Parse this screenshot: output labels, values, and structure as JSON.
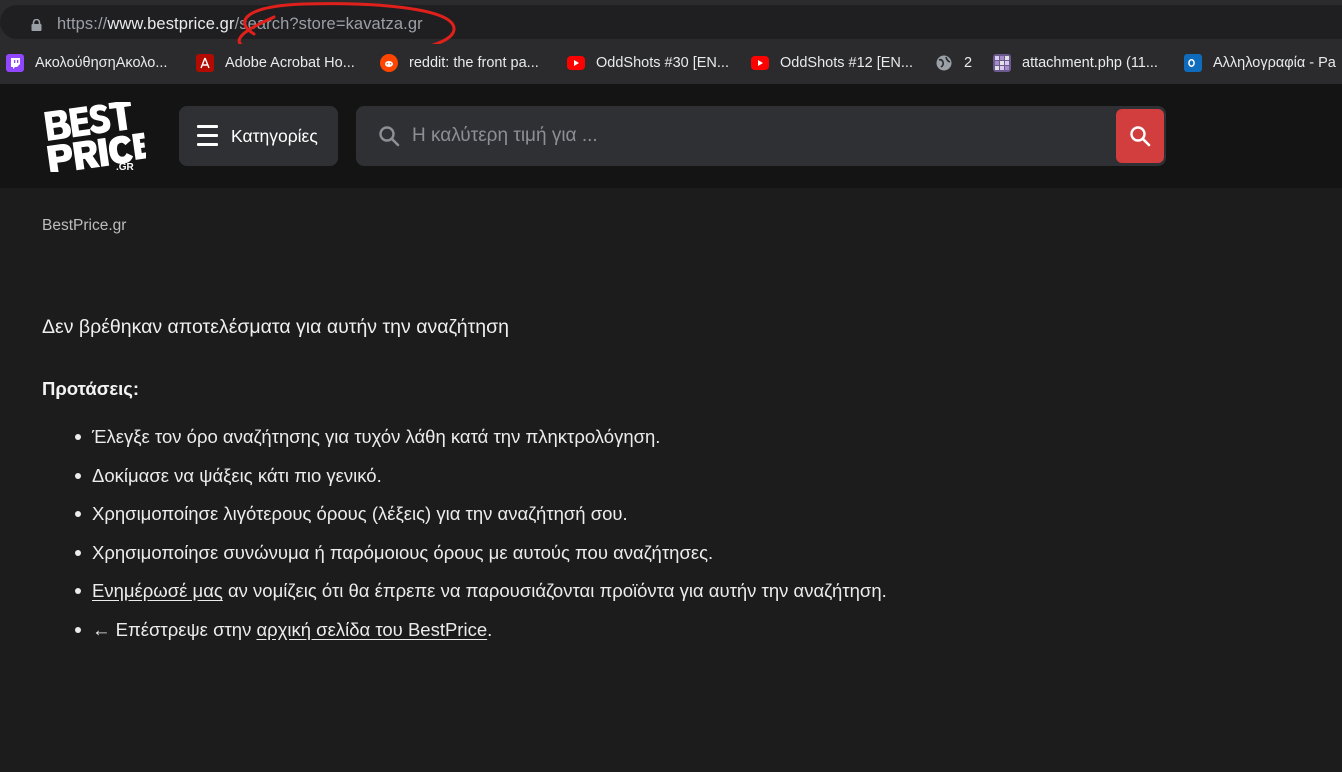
{
  "browser": {
    "url_prefix": "https://",
    "url_host": "www.bestprice.gr",
    "url_path": "/search?store=kavatza.gr"
  },
  "bookmarks": [
    {
      "label": "ΑκολούθησηΑκολο...",
      "icon": "twitch-icon",
      "color": "#9146ff"
    },
    {
      "label": "Adobe Acrobat Ho...",
      "icon": "acrobat-icon",
      "color": "#b30b00"
    },
    {
      "label": "reddit: the front pa...",
      "icon": "reddit-icon",
      "color": "#ff4500"
    },
    {
      "label": "OddShots #30 [EN...",
      "icon": "youtube-icon",
      "color": "#ff0000"
    },
    {
      "label": "OddShots #12 [EN...",
      "icon": "youtube-icon",
      "color": "#ff0000"
    },
    {
      "label": "2",
      "icon": "globe-icon",
      "color": "#9aa0a6"
    },
    {
      "label": "attachment.php (11...",
      "icon": "image-icon",
      "color": "#6b5a8e"
    },
    {
      "label": "Αλληλογραφία - Pa",
      "icon": "outlook-icon",
      "color": "#0f6cbd"
    }
  ],
  "header": {
    "categories_label": "Κατηγορίες",
    "search_placeholder": "Η καλύτερη τιμή για ..."
  },
  "content": {
    "breadcrumb": "BestPrice.gr",
    "no_results": "Δεν βρέθηκαν αποτελέσματα για αυτήν την αναζήτηση",
    "suggestions_title": "Προτάσεις:",
    "suggestions": [
      "Έλεγξε τον όρο αναζήτησης για τυχόν λάθη κατά την πληκτρολόγηση.",
      "Δοκίμασε να ψάξεις κάτι πιο γενικό.",
      "Χρησιμοποίησε λιγότερους όρους (λέξεις) για την αναζήτησή σου.",
      "Χρησιμοποίησε συνώνυμα ή παρόμοιους όρους με αυτούς που αναζήτησες."
    ],
    "notify_link": "Ενημέρωσέ μας",
    "notify_text": " αν νομίζεις ότι θα έπρεπε να παρουσιάζονται προϊόντα για αυτήν την αναζήτηση.",
    "back_prefix": "← Επέστρεψε στην ",
    "back_link": "αρχική σελίδα του BestPrice",
    "back_suffix": "."
  },
  "colors": {
    "accent_red": "#d23d3d",
    "page_bg": "#1c1c1c",
    "header_bg": "#141414"
  }
}
